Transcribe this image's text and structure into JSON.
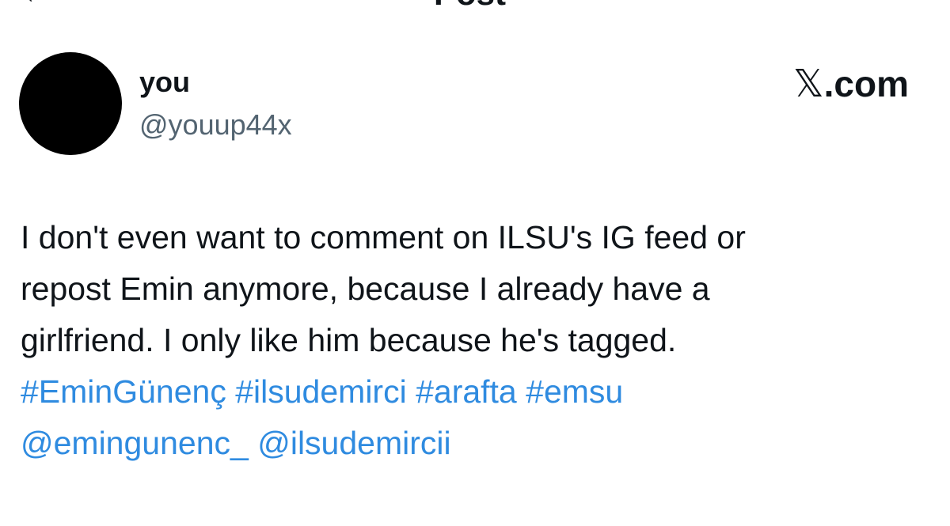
{
  "header": {
    "back_icon": "arrow-left-icon",
    "title": "Post"
  },
  "author": {
    "display_name": "you",
    "handle": "@youup44x",
    "avatar_color": "#000000"
  },
  "brand": {
    "logo_text": ".com",
    "logo_icon": "x-logo-icon"
  },
  "post": {
    "lines": [
      "I don't even want to comment on ILSU's IG feed or",
      "repost Emin anymore, because I already have a",
      "girlfriend. I only like him because he's tagged."
    ],
    "hashtags": [
      "#EminGünenç",
      "#ilsudemirci",
      "#arafta",
      "#emsu"
    ],
    "mentions": [
      "@emingunenc_",
      "@ilsudemircii"
    ]
  },
  "colors": {
    "text": "#0f1419",
    "secondary": "#536471",
    "link": "#2f8be0",
    "background": "#ffffff"
  }
}
